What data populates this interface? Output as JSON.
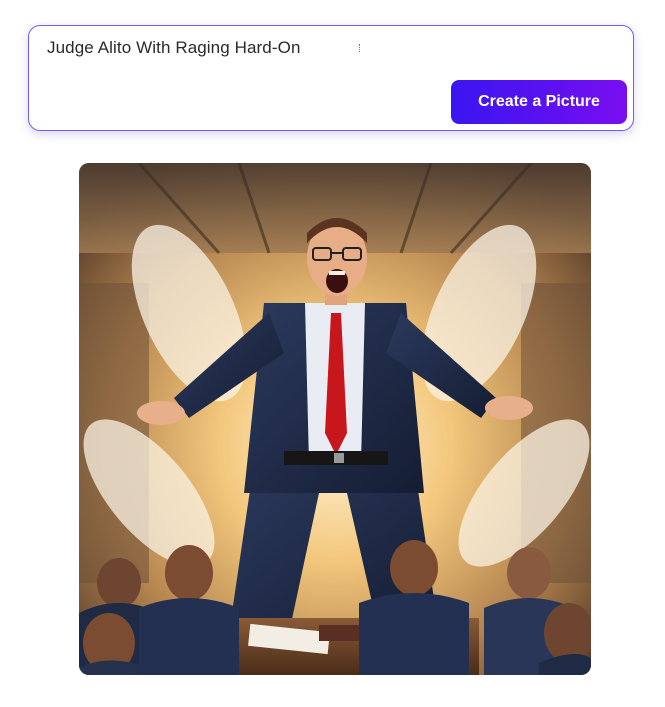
{
  "prompt": {
    "value": "Judge Alito With Raging Hard-On"
  },
  "actions": {
    "create_label": "Create a Picture"
  },
  "colors": {
    "accent_start": "#3a16f0",
    "accent_end": "#7a0ef0",
    "card_border": "#6d5cf5"
  },
  "icons": {
    "generated_image": "painted-illustration"
  }
}
